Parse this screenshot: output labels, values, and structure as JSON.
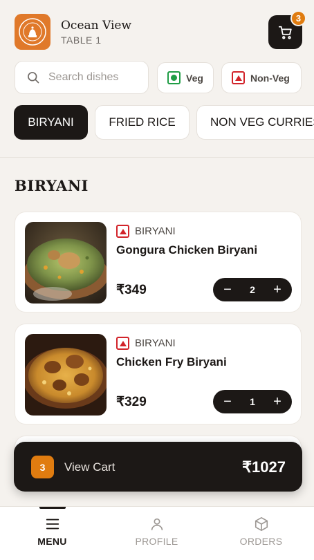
{
  "header": {
    "restaurant_name": "Ocean View",
    "table_label": "TABLE 1",
    "cart_count": "3"
  },
  "search": {
    "placeholder": "Search dishes"
  },
  "filters": {
    "veg_label": "Veg",
    "nonveg_label": "Non-Veg"
  },
  "categories": [
    {
      "label": "BIRYANI",
      "active": true
    },
    {
      "label": "FRIED RICE",
      "active": false
    },
    {
      "label": "NON VEG CURRIES",
      "active": false
    }
  ],
  "section": {
    "title": "BIRYANI"
  },
  "items": [
    {
      "category": "BIRYANI",
      "name": "Gongura Chicken Biryani",
      "price": "₹349",
      "qty": "2",
      "minus": "−",
      "plus": "+"
    },
    {
      "category": "BIRYANI",
      "name": "Chicken Fry Biryani",
      "price": "₹329",
      "qty": "1",
      "minus": "−",
      "plus": "+"
    }
  ],
  "cart_bar": {
    "count": "3",
    "label": "View Cart",
    "total": "₹1027"
  },
  "nav": [
    {
      "label": "MENU",
      "icon": "menu-icon",
      "active": true
    },
    {
      "label": "PROFILE",
      "icon": "user-icon",
      "active": false
    },
    {
      "label": "ORDERS",
      "icon": "package-icon",
      "active": false
    }
  ],
  "colors": {
    "background": "#f5f2ee",
    "dark": "#1c1816",
    "accent": "#e07c10",
    "veg": "#1f9d45",
    "nonveg": "#d2232a"
  }
}
